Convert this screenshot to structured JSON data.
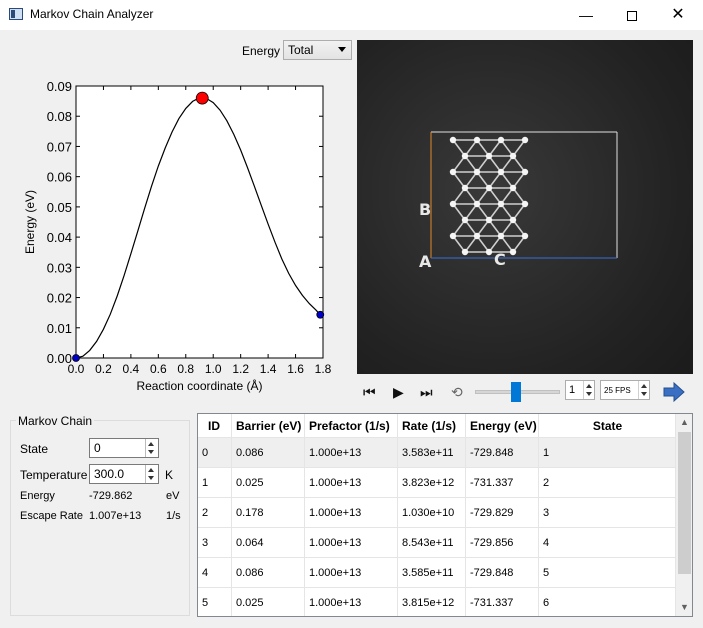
{
  "window": {
    "title": "Markov Chain Analyzer",
    "min": "—",
    "close": "✕"
  },
  "energy_select": {
    "label": "Energy",
    "value": "Total"
  },
  "chart_data": {
    "type": "line",
    "xlabel": "Reaction coordinate (Å)",
    "ylabel": "Energy (eV)",
    "xlim": [
      0.0,
      1.8
    ],
    "ylim": [
      0.0,
      0.09
    ],
    "xticks": [
      "0.0",
      "0.2",
      "0.4",
      "0.6",
      "0.8",
      "1.0",
      "1.2",
      "1.4",
      "1.6",
      "1.8"
    ],
    "yticks": [
      "0.00",
      "0.01",
      "0.02",
      "0.03",
      "0.04",
      "0.05",
      "0.06",
      "0.07",
      "0.08",
      "0.09"
    ],
    "x": [
      0.0,
      0.05,
      0.1,
      0.15,
      0.2,
      0.25,
      0.3,
      0.35,
      0.4,
      0.45,
      0.5,
      0.55,
      0.6,
      0.65,
      0.7,
      0.75,
      0.8,
      0.85,
      0.9,
      0.95,
      1.0,
      1.05,
      1.1,
      1.15,
      1.2,
      1.25,
      1.3,
      1.35,
      1.4,
      1.45,
      1.5,
      1.55,
      1.6,
      1.65,
      1.7,
      1.75,
      1.78
    ],
    "y": [
      0.0,
      0.0006,
      0.0025,
      0.0055,
      0.0095,
      0.0145,
      0.0205,
      0.0272,
      0.0345,
      0.042,
      0.0495,
      0.0568,
      0.0635,
      0.0695,
      0.0748,
      0.0792,
      0.0826,
      0.0849,
      0.0861,
      0.0859,
      0.0845,
      0.082,
      0.0785,
      0.074,
      0.0688,
      0.063,
      0.0568,
      0.0505,
      0.0443,
      0.0383,
      0.0328,
      0.028,
      0.024,
      0.0207,
      0.018,
      0.0158,
      0.0143
    ],
    "points": [
      {
        "x": 0.0,
        "y": 0.0,
        "color": "#0000cc"
      },
      {
        "x": 0.92,
        "y": 0.086,
        "color": "#ff0000"
      },
      {
        "x": 1.78,
        "y": 0.0143,
        "color": "#0000cc"
      }
    ]
  },
  "viewer": {
    "labels": [
      "B",
      "A",
      "C"
    ]
  },
  "playback": {
    "frame": "1",
    "fps": "25 FPS",
    "slider": 0.48
  },
  "markov": {
    "title": "Markov Chain",
    "state_label": "State",
    "state_value": "0",
    "temp_label": "Temperature",
    "temp_value": "300.0",
    "temp_unit": "K",
    "energy_label": "Energy",
    "energy_value": "-729.862",
    "energy_unit": "eV",
    "escape_label": "Escape Rate",
    "escape_value": "1.007e+13",
    "escape_unit": "1/s"
  },
  "table": {
    "headers": [
      "ID",
      "Barrier (eV)",
      "Prefactor (1/s)",
      "Rate (1/s)",
      "Energy (eV)",
      "State"
    ],
    "rows": [
      [
        "0",
        "0.086",
        "1.000e+13",
        "3.583e+11",
        "-729.848",
        "1"
      ],
      [
        "1",
        "0.025",
        "1.000e+13",
        "3.823e+12",
        "-731.337",
        "2"
      ],
      [
        "2",
        "0.178",
        "1.000e+13",
        "1.030e+10",
        "-729.829",
        "3"
      ],
      [
        "3",
        "0.064",
        "1.000e+13",
        "8.543e+11",
        "-729.856",
        "4"
      ],
      [
        "4",
        "0.086",
        "1.000e+13",
        "3.585e+11",
        "-729.848",
        "5"
      ],
      [
        "5",
        "0.025",
        "1.000e+13",
        "3.815e+12",
        "-731.337",
        "6"
      ]
    ]
  }
}
